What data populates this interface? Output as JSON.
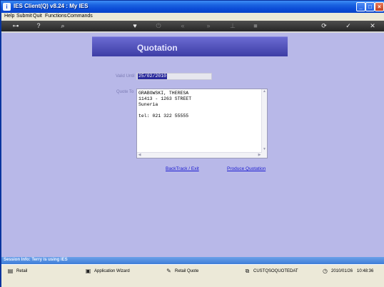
{
  "window": {
    "title": "IES Client(Q) v8.24 : My IES",
    "icon": "ies-app-icon"
  },
  "menu": [
    "Help",
    "Submit",
    "Quit",
    "Functions",
    "Commands"
  ],
  "toolbar": {
    "icons": [
      "key-icon",
      "help-icon",
      "search-icon",
      "heart-icon",
      "power-icon",
      "rewind-icon",
      "fast-forward-icon",
      "download-icon",
      "stop-icon",
      "refresh-icon",
      "check-icon",
      "close-icon"
    ]
  },
  "form": {
    "header": "Quotation",
    "valid_until_label": "Valid Until",
    "valid_until_value": "25/02/2010",
    "quote_to_label": "Quote To",
    "quote_to_value": "GRABOWSKI, THERESA\n11413 - 1263 STREET\nSuneria\n\ntel: 021 322 55555",
    "links": {
      "backtrack": "BackTrack / Exit",
      "produce": "Produce Quotation"
    }
  },
  "session": {
    "info": "Session Info: Terry is using IES"
  },
  "statusbar": {
    "retail": "Retail",
    "wizard": "Application Wizard",
    "retail_quote": "Retail Quote",
    "code": "CUSTQSOQUOTEDAT",
    "date": "2010/01/26",
    "time": "10:48:36"
  }
}
